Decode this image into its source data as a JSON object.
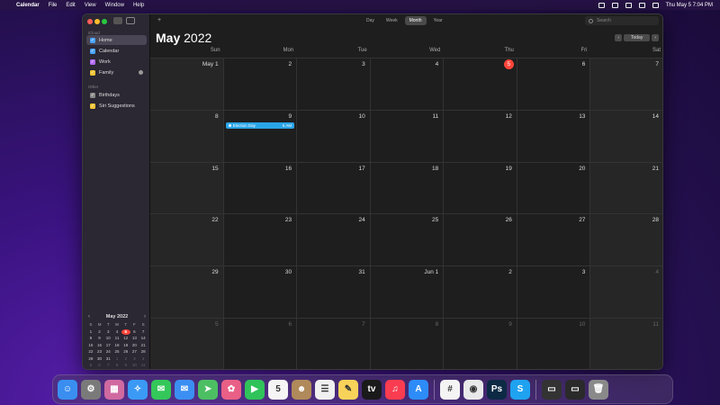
{
  "menubar": {
    "apple": "",
    "items": [
      "Calendar",
      "File",
      "Edit",
      "View",
      "Window",
      "Help"
    ],
    "datetime": "Thu May 5  7:04 PM"
  },
  "sidebar": {
    "section_icloud": "iCloud",
    "calendars": [
      {
        "label": "Home",
        "color": "#4aa3ff",
        "checked": true
      },
      {
        "label": "Calendar",
        "color": "#4aa3ff",
        "checked": true
      },
      {
        "label": "Work",
        "color": "#b36bff",
        "checked": true
      },
      {
        "label": "Family",
        "color": "#f4c534",
        "checked": true
      }
    ],
    "section_other": "Other",
    "other": [
      {
        "label": "Birthdays",
        "color": "#8a8a8a",
        "checked": true
      },
      {
        "label": "Siri Suggestions",
        "color": "#f4c534",
        "checked": true
      }
    ]
  },
  "mini_calendar": {
    "title": "May 2022",
    "prev": "‹",
    "next": "›",
    "dow": [
      "S",
      "M",
      "T",
      "W",
      "T",
      "F",
      "S"
    ],
    "weeks": [
      [
        "1",
        "2",
        "3",
        "4",
        "5",
        "6",
        "7"
      ],
      [
        "8",
        "9",
        "10",
        "11",
        "12",
        "13",
        "14"
      ],
      [
        "15",
        "16",
        "17",
        "18",
        "19",
        "20",
        "21"
      ],
      [
        "22",
        "23",
        "24",
        "25",
        "26",
        "27",
        "28"
      ],
      [
        "29",
        "30",
        "31",
        "1",
        "2",
        "3",
        "4"
      ],
      [
        "5",
        "6",
        "7",
        "8",
        "9",
        "10",
        "11"
      ]
    ],
    "today": "5"
  },
  "toolbar": {
    "add": "+",
    "views": [
      "Day",
      "Week",
      "Month",
      "Year"
    ],
    "active_view": "Month",
    "search_placeholder": "Search"
  },
  "header": {
    "month": "May",
    "year": "2022",
    "prev": "‹",
    "today": "Today",
    "next": "›"
  },
  "weekdays": [
    "Sun",
    "Mon",
    "Tue",
    "Wed",
    "Thu",
    "Fri",
    "Sat"
  ],
  "days": [
    "May 1",
    "2",
    "3",
    "4",
    "5",
    "6",
    "7",
    "8",
    "9",
    "10",
    "11",
    "12",
    "13",
    "14",
    "15",
    "16",
    "17",
    "18",
    "19",
    "20",
    "21",
    "22",
    "23",
    "24",
    "25",
    "26",
    "27",
    "28",
    "29",
    "30",
    "31",
    "Jun 1",
    "2",
    "3",
    "4",
    "5",
    "6",
    "7",
    "8",
    "9",
    "10",
    "11"
  ],
  "today_index": 4,
  "events": [
    {
      "day_index": 8,
      "title": "Election Day",
      "time": "6 AM",
      "color": "#2aa5e8"
    }
  ],
  "dock": [
    {
      "name": "finder-icon",
      "glyph": "☺",
      "color": "#3a8ef0"
    },
    {
      "name": "system-preferences-icon",
      "glyph": "⚙",
      "color": "#7a7a7a"
    },
    {
      "name": "launchpad-icon",
      "glyph": "▦",
      "color": "#d06aa0"
    },
    {
      "name": "safari-icon",
      "glyph": "✧",
      "color": "#3a9af5"
    },
    {
      "name": "messages-icon",
      "glyph": "✉",
      "color": "#34c759"
    },
    {
      "name": "mail-icon",
      "glyph": "✉",
      "color": "#3b8ff3"
    },
    {
      "name": "maps-icon",
      "glyph": "➤",
      "color": "#4cbf63"
    },
    {
      "name": "photos-icon",
      "glyph": "✿",
      "color": "#e95f86"
    },
    {
      "name": "facetime-icon",
      "glyph": "▶",
      "color": "#2fc35a"
    },
    {
      "name": "calendar-icon",
      "glyph": "5",
      "color": "#f5f5f5"
    },
    {
      "name": "contacts-icon",
      "glyph": "☻",
      "color": "#b08a5a"
    },
    {
      "name": "reminders-icon",
      "glyph": "☰",
      "color": "#f0f0f0"
    },
    {
      "name": "notes-icon",
      "glyph": "✎",
      "color": "#f7d35a"
    },
    {
      "name": "tv-icon",
      "glyph": "tv",
      "color": "#1a1a1a"
    },
    {
      "name": "music-icon",
      "glyph": "♫",
      "color": "#fa3c50"
    },
    {
      "name": "app-store-icon",
      "glyph": "A",
      "color": "#2d8cf7"
    },
    {
      "name": "slack-icon",
      "glyph": "#",
      "color": "#f4f4f4"
    },
    {
      "name": "chrome-icon",
      "glyph": "◉",
      "color": "#e9e9e9"
    },
    {
      "name": "photoshop-icon",
      "glyph": "Ps",
      "color": "#0d2a45"
    },
    {
      "name": "skype-icon",
      "glyph": "S",
      "color": "#1fa2f0"
    },
    {
      "name": "screenshot-thumb-icon",
      "glyph": "▭",
      "color": "#333"
    },
    {
      "name": "window-thumb-icon",
      "glyph": "▭",
      "color": "#2a2a2a"
    },
    {
      "name": "trash-icon",
      "glyph": "🗑",
      "color": "#8a8a8a"
    }
  ]
}
